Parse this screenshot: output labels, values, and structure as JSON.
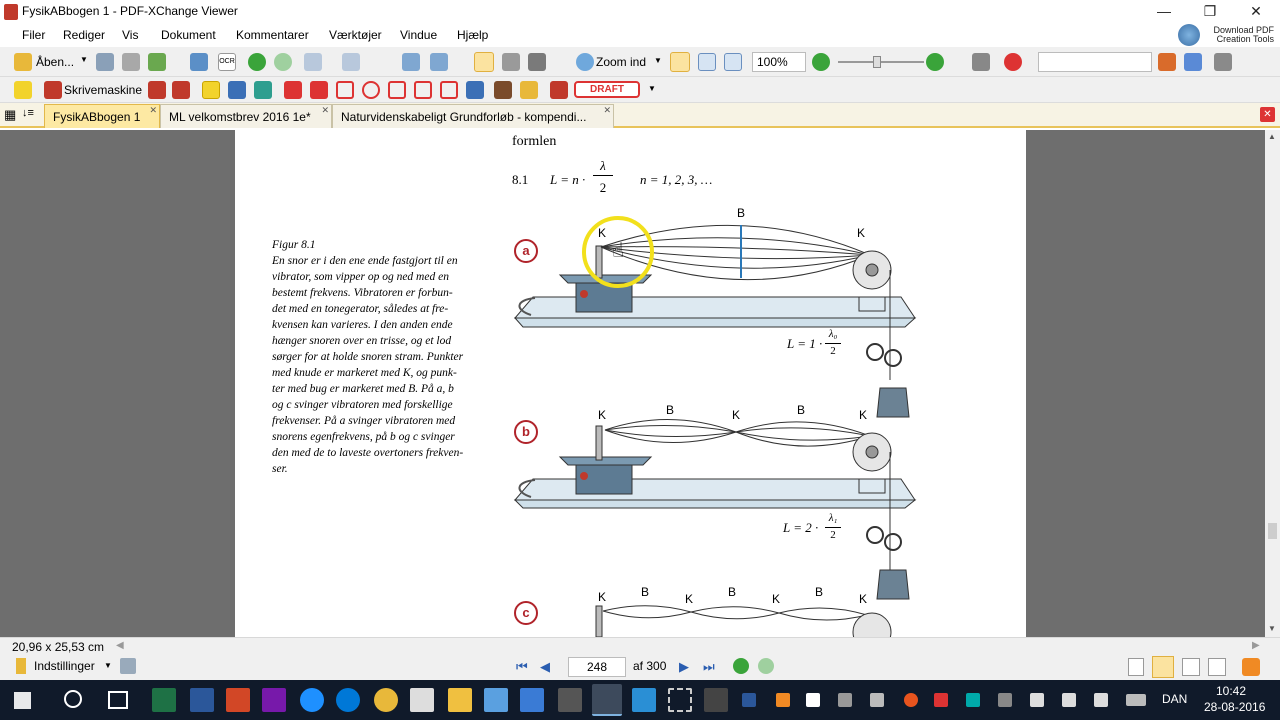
{
  "window": {
    "title": "FysikABbogen 1 - PDF-XChange Viewer",
    "minimize": "—",
    "restore": "❐",
    "close": "✕"
  },
  "menu": [
    "Filer",
    "Rediger",
    "Vis",
    "Dokument",
    "Kommentarer",
    "Værktøjer",
    "Vindue",
    "Hjælp"
  ],
  "download_pdf": {
    "line1": "Download PDF",
    "line2": "Creation Tools"
  },
  "toolbar1": {
    "open_label": "Åben...",
    "zoom_in_label": "Zoom ind",
    "zoom_value": "100%",
    "ocr": "OCR"
  },
  "toolbar2": {
    "typewriter_label": "Skrivemaskine",
    "draft_stamp": "DRAFT"
  },
  "tabs": [
    {
      "label": "FysikABbogen 1",
      "active": true
    },
    {
      "label": "ML velkomstbrev 2016 1e*",
      "active": false
    },
    {
      "label": "Naturvidenskabeligt Grundforløb - kompendi...",
      "active": false
    }
  ],
  "document": {
    "formula_intro": "formlen",
    "eq_number": "8.1",
    "eq_lhs": "L = n ·",
    "eq_frac_num": "λ",
    "eq_frac_den": "2",
    "eq_n_values": "n = 1, 2, 3, …",
    "caption_title": "Figur 8.1",
    "caption_lines": [
      "En snor er i den ene ende fastgjort til en",
      "vibrator, som vipper op og ned med en",
      "bestemt frekvens. Vibratoren er forbun-",
      "det med en tonegerator, således at fre-",
      "kvensen kan varieres. I den anden ende",
      "hænger snoren over en trisse, og et lod",
      "sørger for at holde snoren stram. Punkter",
      "med knude er markeret med K, og punk-",
      "ter med bug er markeret med B. På a, b",
      "og c svinger vibratoren med forskellige",
      "frekvenser. På a svinger vibratoren med",
      "snorens egenfrekvens, på b og c svinger",
      "den med de to laveste overtoners frekven-",
      "ser."
    ],
    "fig_a": {
      "label": "a",
      "nodes": [
        "K",
        "K"
      ],
      "antinodes": [
        "B"
      ],
      "formula_lhs": "L = 1 ·",
      "formula_num": "λ₀",
      "formula_den": "2"
    },
    "fig_b": {
      "label": "b",
      "nodes": [
        "K",
        "K",
        "K"
      ],
      "antinodes": [
        "B",
        "B"
      ],
      "formula_lhs": "L = 2 ·",
      "formula_num": "λ₁",
      "formula_den": "2"
    },
    "fig_c": {
      "label": "c",
      "nodes": [
        "K",
        "K",
        "K",
        "K"
      ],
      "antinodes": [
        "B",
        "B",
        "B"
      ]
    }
  },
  "statusbar": {
    "dimensions": "20,96 x 25,53 cm"
  },
  "navbar": {
    "settings_label": "Indstillinger",
    "page_current": "248",
    "page_total": "af 300"
  },
  "taskbar": {
    "language": "DAN",
    "time": "10:42",
    "date": "28-08-2016"
  },
  "colors": {
    "tab_active": "#fde9a3",
    "doc_bg": "#6e6e6e",
    "taskbar": "#101a2a",
    "highlight_ring": "#f2e01c",
    "figure_label": "#b0232a"
  }
}
